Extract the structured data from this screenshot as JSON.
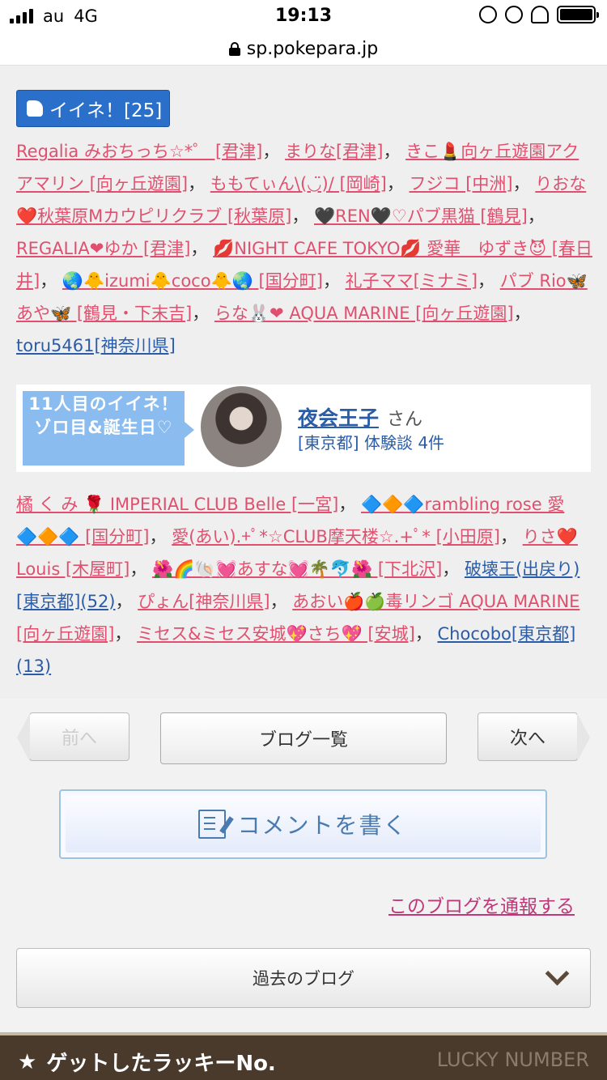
{
  "status": {
    "carrier": "au",
    "network": "4G",
    "time": "19:13"
  },
  "url": "sp.pokepara.jp",
  "like": {
    "label": "イイネ！[25]"
  },
  "likers_a": [
    {
      "t": "Regalia みおちっち☆*゜ [君津]",
      "c": "pink"
    },
    {
      "t": "まりな[君津]",
      "c": "pink"
    },
    {
      "t": "きこ💄向ヶ丘遊園アクアマリン [向ヶ丘遊園]",
      "c": "pink"
    },
    {
      "t": "ももてぃん\\(◡̈)/ [岡崎]",
      "c": "pink"
    },
    {
      "t": "フジコ [中洲]",
      "c": "pink"
    },
    {
      "t": "りおな❤️秋葉原Mカウピリクラブ [秋葉原]",
      "c": "pink"
    },
    {
      "t": "🖤REN🖤♡パブ黒猫 [鶴見]",
      "c": "pink"
    },
    {
      "t": "REGALIA❤ゆか [君津]",
      "c": "pink"
    },
    {
      "t": "💋NIGHT CAFE TOKYO💋 愛華　ゆずき😈 [春日井]",
      "c": "pink"
    },
    {
      "t": "🌏🐥izumi🐥coco🐥🌏 [国分町]",
      "c": "pink"
    },
    {
      "t": "礼子ママ[ミナミ]",
      "c": "pink"
    },
    {
      "t": "パブ Rio🦋あや🦋 [鶴見・下末吉]",
      "c": "pink"
    },
    {
      "t": "らな🐰❤ AQUA MARINE [向ヶ丘遊園]",
      "c": "pink"
    },
    {
      "t": "toru5461[神奈川県]",
      "c": "blue"
    }
  ],
  "feature": {
    "label": "11人目のイイネ！\nゾロ目&誕生日♡",
    "name": "夜会王子",
    "suffix": "さん",
    "sub": "[東京都] 体験談 4件"
  },
  "likers_b": [
    {
      "t": "橘 く み 🌹 IMPERIAL CLUB Belle [一宮]",
      "c": "pink"
    },
    {
      "t": "🔷🔶🔷rambling rose 愛🔷🔶🔷 [国分町]",
      "c": "pink"
    },
    {
      "t": "愛(あい).+ﾟ*☆CLUB摩天楼☆.+ﾟ* [小田原]",
      "c": "pink"
    },
    {
      "t": "りさ❤️Louis [木屋町]",
      "c": "pink"
    },
    {
      "t": "🌺🌈🐚💓あすな💓🌴🐬🌺 [下北沢]",
      "c": "pink"
    },
    {
      "t": "破壊王(出戻り)[東京都](52)",
      "c": "blue"
    },
    {
      "t": "ぴょん[神奈川県]",
      "c": "pink"
    },
    {
      "t": "あおい🍎🍏毒リンゴ AQUA MARINE [向ヶ丘遊園]",
      "c": "pink"
    },
    {
      "t": "ミセス&ミセス安城💖さち💖 [安城]",
      "c": "pink"
    },
    {
      "t": "Chocobo[東京都](13)",
      "c": "blue"
    }
  ],
  "nav": {
    "prev": "前へ",
    "list": "ブログ一覧",
    "next": "次へ"
  },
  "comment": "コメントを書く",
  "report": "このブログを通報する",
  "past": "過去のブログ",
  "lucky": {
    "title": "ゲットしたラッキーNo.",
    "en": "LUCKY NUMBER"
  }
}
